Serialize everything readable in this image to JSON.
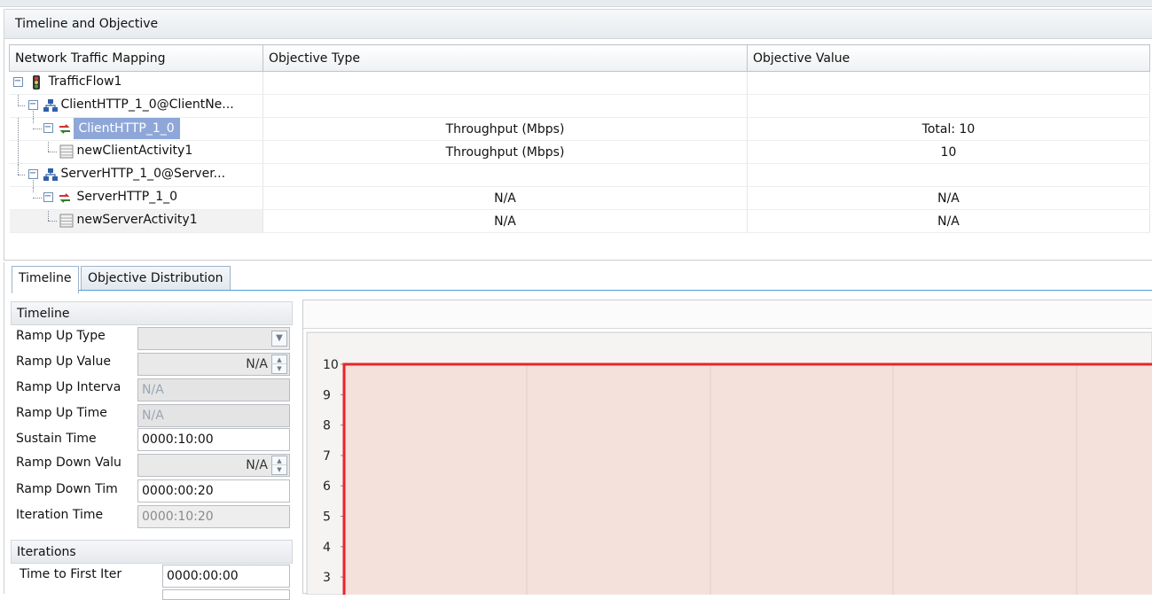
{
  "panel": {
    "title": "Timeline and Objective"
  },
  "grid": {
    "columns": [
      "Network Traffic Mapping",
      "Objective Type",
      "Objective Value"
    ],
    "rows": [
      {
        "label": "TrafficFlow1",
        "type": "",
        "value": ""
      },
      {
        "label": "ClientHTTP_1_0@ClientNe...",
        "type": "",
        "value": ""
      },
      {
        "label": "ClientHTTP_1_0",
        "type": "Throughput (Mbps)",
        "value": "Total: 10"
      },
      {
        "label": "newClientActivity1",
        "type": "Throughput (Mbps)",
        "value": "10"
      },
      {
        "label": "ServerHTTP_1_0@Server...",
        "type": "",
        "value": ""
      },
      {
        "label": "ServerHTTP_1_0",
        "type": "N/A",
        "value": "N/A"
      },
      {
        "label": "newServerActivity1",
        "type": "N/A",
        "value": "N/A"
      }
    ]
  },
  "tabs": [
    {
      "label": "Timeline"
    },
    {
      "label": "Objective Distribution"
    }
  ],
  "timeline": {
    "title": "Timeline",
    "ramp_up_type_label": "Ramp Up Type",
    "ramp_up_type_value": "",
    "ramp_up_value_label": "Ramp Up Value",
    "ramp_up_value": "N/A",
    "ramp_up_interval_label": "Ramp Up Interva",
    "ramp_up_interval": "N/A",
    "ramp_up_time_label": "Ramp Up Time",
    "ramp_up_time": "N/A",
    "sustain_time_label": "Sustain Time",
    "sustain_time": "0000:10:00",
    "ramp_down_value_label": "Ramp Down Valu",
    "ramp_down_value": "N/A",
    "ramp_down_time_label": "Ramp Down Tim",
    "ramp_down_time": "0000:00:20",
    "iteration_time_label": "Iteration Time",
    "iteration_time": "0000:10:20"
  },
  "iterations": {
    "title": "Iterations",
    "time_to_first_label": "Time to First Iter",
    "time_to_first": "0000:00:00"
  },
  "chart_data": {
    "type": "area",
    "y_ticks": [
      "10",
      "9",
      "8",
      "7",
      "6",
      "5",
      "4",
      "3"
    ],
    "ylim": [
      3,
      10
    ],
    "level": 10,
    "colors": {
      "line": "#e8252b",
      "fill": "#f5e1dc"
    }
  }
}
